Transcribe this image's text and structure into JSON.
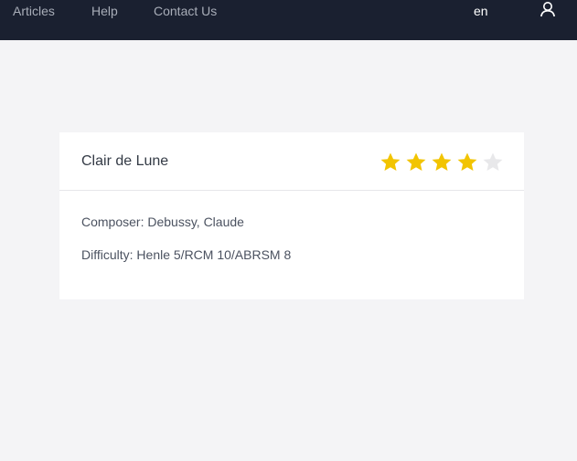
{
  "nav": {
    "links": [
      "Articles",
      "Help",
      "Contact Us"
    ],
    "language": "en",
    "user_icon": "user-icon"
  },
  "piece": {
    "title": "Clair de Lune",
    "rating": {
      "value": 4,
      "max": 5
    },
    "composer_line": "Composer: Debussy, Claude",
    "difficulty_line": "Difficulty: Henle 5/RCM 10/ABRSM 8"
  },
  "colors": {
    "topbar": "#1a2030",
    "star_filled": "#f2c400",
    "star_empty": "#e8e8ea"
  }
}
